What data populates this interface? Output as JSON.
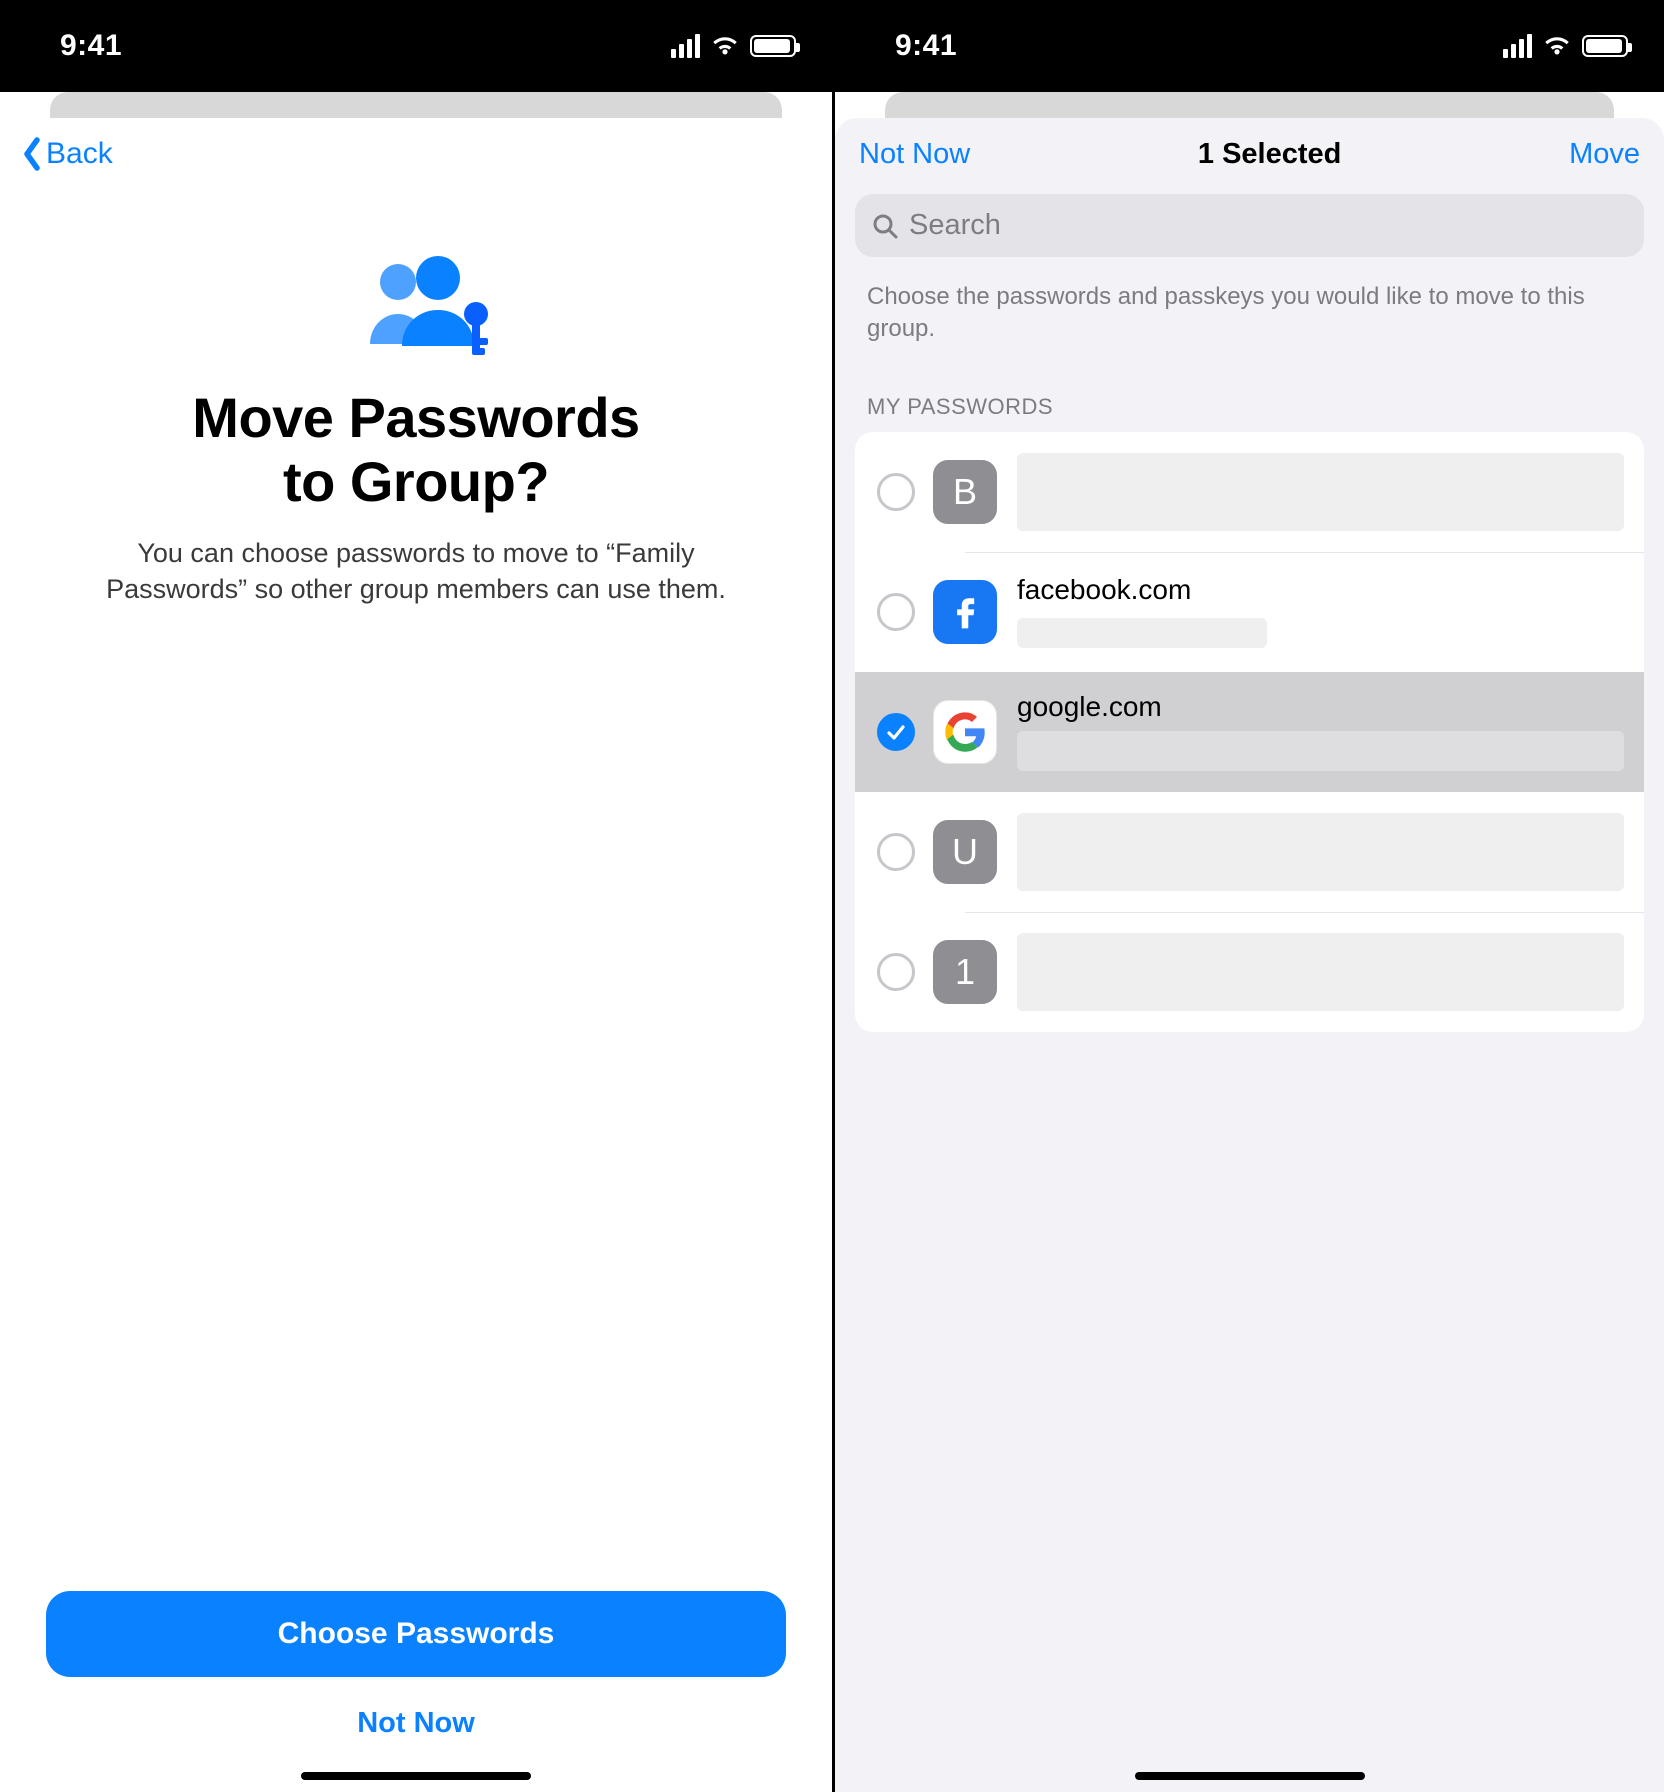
{
  "status": {
    "time": "9:41"
  },
  "left": {
    "back": "Back",
    "title_line1": "Move Passwords",
    "title_line2": "to Group?",
    "subtitle": "You can choose passwords to move to “Family Passwords” so other group members can use them.",
    "primary": "Choose Passwords",
    "secondary": "Not Now"
  },
  "right": {
    "nav_left": "Not Now",
    "nav_title": "1 Selected",
    "nav_right": "Move",
    "search_placeholder": "Search",
    "helper": "Choose the passwords and passkeys you would like to move to this group.",
    "section": "MY PASSWORDS",
    "items": [
      {
        "letter": "B",
        "site": "",
        "selected": false,
        "icon": "letter-gray"
      },
      {
        "letter": "f",
        "site": "facebook.com",
        "selected": false,
        "icon": "facebook"
      },
      {
        "letter": "G",
        "site": "google.com",
        "selected": true,
        "icon": "google"
      },
      {
        "letter": "U",
        "site": "",
        "selected": false,
        "icon": "letter-gray"
      },
      {
        "letter": "1",
        "site": "",
        "selected": false,
        "icon": "letter-gray"
      }
    ]
  }
}
